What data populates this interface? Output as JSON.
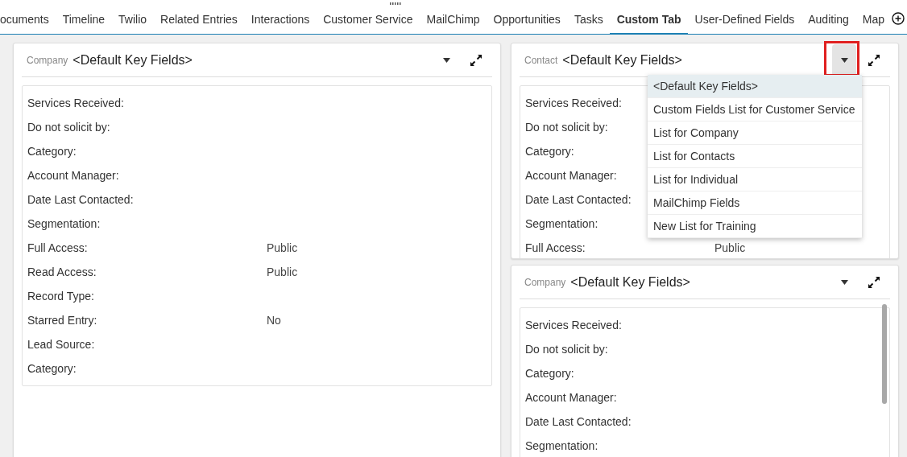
{
  "tabs": [
    {
      "label": "ocuments",
      "selected": false
    },
    {
      "label": "Timeline",
      "selected": false
    },
    {
      "label": "Twilio",
      "selected": false
    },
    {
      "label": "Related Entries",
      "selected": false
    },
    {
      "label": "Interactions",
      "selected": false
    },
    {
      "label": "Customer Service",
      "selected": false
    },
    {
      "label": "MailChimp",
      "selected": false
    },
    {
      "label": "Opportunities",
      "selected": false
    },
    {
      "label": "Tasks",
      "selected": false
    },
    {
      "label": "Custom Tab",
      "selected": true
    },
    {
      "label": "User-Defined Fields",
      "selected": false
    },
    {
      "label": "Auditing",
      "selected": false
    },
    {
      "label": "Map",
      "selected": false
    }
  ],
  "panels": [
    {
      "entity": "Company",
      "title": "<Default Key Fields>",
      "dropdown_open": false,
      "highlighted": false,
      "fields": [
        {
          "label": "Services Received:"
        },
        {
          "label": "Do not solicit by:"
        },
        {
          "label": "Category:"
        },
        {
          "label": "Account Manager:"
        },
        {
          "label": "Date Last Contacted:"
        },
        {
          "label": "Segmentation:"
        },
        {
          "label": "Full Access:",
          "value": "Public"
        },
        {
          "label": "Read Access:",
          "value": "Public"
        },
        {
          "label": "Record Type:"
        },
        {
          "label": "Starred Entry:",
          "value": "No"
        },
        {
          "label": "Lead Source:"
        },
        {
          "label": "Category:"
        }
      ]
    },
    {
      "entity": "Contact",
      "title": "<Default Key Fields>",
      "dropdown_open": true,
      "highlighted": true,
      "fields": [
        {
          "label": "Services Received:"
        },
        {
          "label": "Do not solicit by:"
        },
        {
          "label": "Category:"
        },
        {
          "label": "Account Manager:"
        },
        {
          "label": "Date Last Contacted:"
        },
        {
          "label": "Segmentation:"
        },
        {
          "label": "Full Access:",
          "value": "Public"
        }
      ],
      "menu": [
        {
          "label": "<Default Key Fields>",
          "selected": true
        },
        {
          "label": "Custom Fields List for Customer Service",
          "selected": false
        },
        {
          "label": "List for Company",
          "selected": false
        },
        {
          "label": "List for Contacts",
          "selected": false
        },
        {
          "label": "List for Individual",
          "selected": false
        },
        {
          "label": "MailChimp Fields",
          "selected": false
        },
        {
          "label": "New List for Training",
          "selected": false
        }
      ]
    },
    {
      "entity": "Company",
      "title": "<Default Key Fields>",
      "dropdown_open": false,
      "highlighted": false,
      "fields": [
        {
          "label": "Services Received:"
        },
        {
          "label": "Do not solicit by:"
        },
        {
          "label": "Category:"
        },
        {
          "label": "Account Manager:"
        },
        {
          "label": "Date Last Contacted:"
        },
        {
          "label": "Segmentation:"
        }
      ]
    }
  ]
}
